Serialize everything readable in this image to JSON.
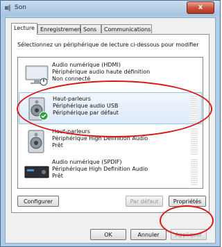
{
  "window": {
    "title": "Son",
    "close_glyph": "x"
  },
  "tabs": [
    "Lecture",
    "Enregistrement",
    "Sons",
    "Communications"
  ],
  "instruction": "Sélectionnez un périphérique de lecture ci-dessous pour modifier",
  "devices": [
    {
      "icon": "hdmi-monitor-icon",
      "name": "Audio numérique (HDMI)",
      "line2": "Périphérique audio haute définition",
      "status": "Non connecté",
      "badge": "disconnected"
    },
    {
      "icon": "speaker-icon",
      "name": "Haut-parleurs",
      "line2": "Périphérique audio USB",
      "status": "Périphérique par défaut",
      "badge": "default-check",
      "selected": true
    },
    {
      "icon": "speaker-icon",
      "name": "Haut-parleurs",
      "line2": "Périphérique High Definition Audio",
      "status": "Prêt"
    },
    {
      "icon": "spdif-receiver-icon",
      "name": "Audio numérique (SPDIF)",
      "line2": "Périphérique High Definition Audio",
      "status": "Prêt"
    }
  ],
  "buttons": {
    "configure": "Configurer",
    "default": "Par défaut",
    "properties": "Propriétés",
    "ok": "OK",
    "cancel": "Annuler",
    "apply": "Appliquer"
  },
  "colors": {
    "highlight_ellipse": "#d81616",
    "selection": "#dcebfc",
    "check_green": "#2ea043"
  }
}
